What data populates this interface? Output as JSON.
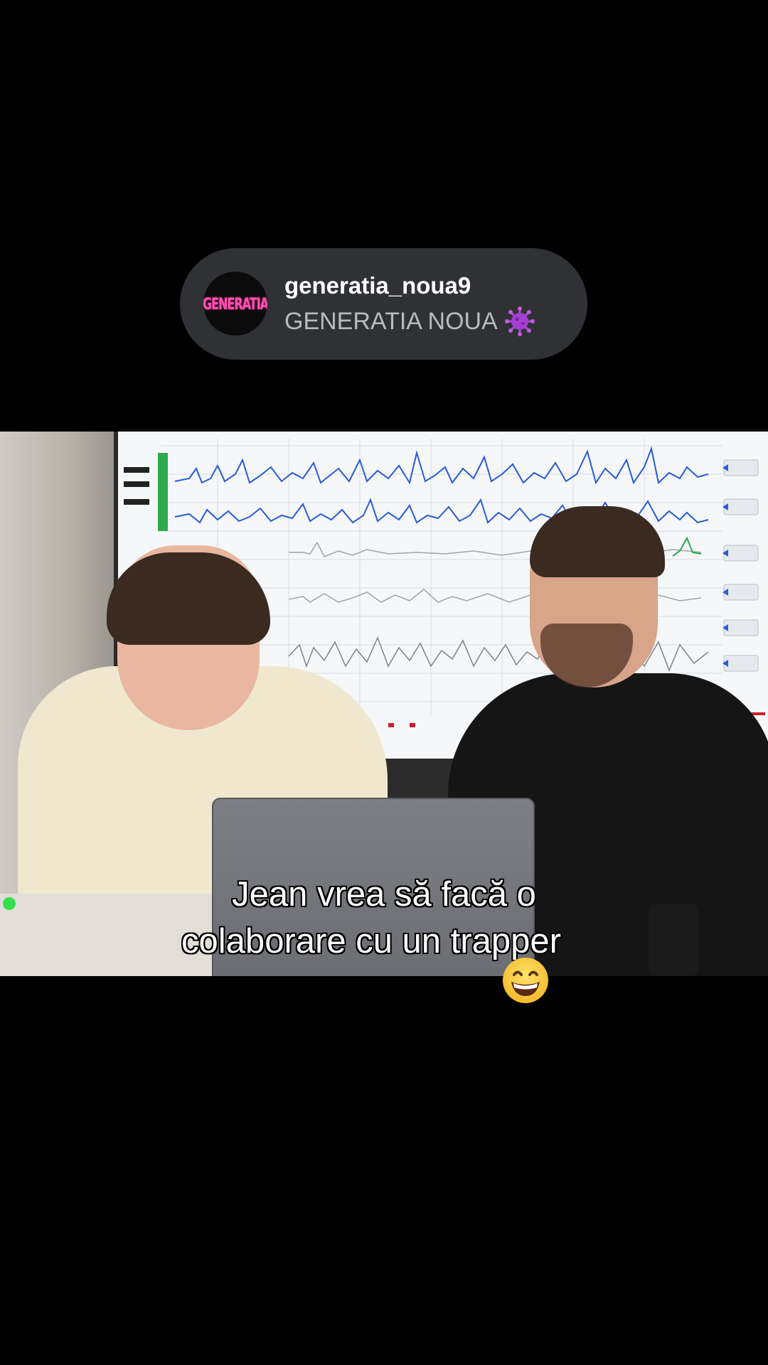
{
  "account": {
    "username": "generatia_noua9",
    "display_name": "GENERATIA NOUA",
    "avatar_text": "GENERATIA",
    "avatar_accent": "#ff4fb0",
    "badge_icon": "purple-virus-emoji"
  },
  "video": {
    "caption_line1": "Jean vrea să facă o",
    "caption_line2": "colaborare cu un trapper",
    "caption_emoji": "grinning-face-emoji",
    "monitor_trace_color": "#2a5bd7",
    "status_dot_color": "#32e04a"
  }
}
